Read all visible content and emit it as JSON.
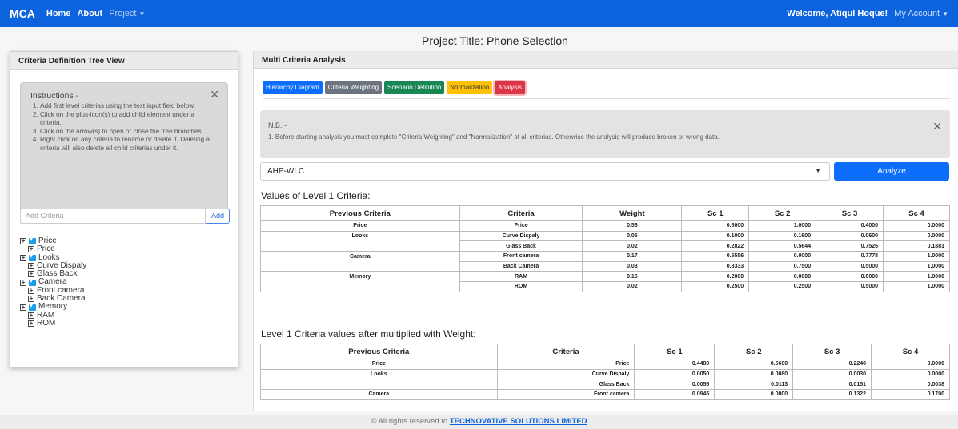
{
  "navbar": {
    "brand": "MCA",
    "home": "Home",
    "about": "About",
    "project": "Project",
    "welcome": "Welcome, Atiqul Hoque!",
    "account": "My Account"
  },
  "project_title": "Project Title: Phone Selection",
  "left_panel": {
    "title": "Criteria Definition Tree View",
    "instructions_title": "Instructions -",
    "instructions": [
      "Add first level criterias using the text input field below.",
      "Click on the plus-icon(s) to add child element under a criteria.",
      "Click on the arrow(s) to open or close the tree branches.",
      "Right click on any criteria to rename or delete it. Deleting a criteria will also delete all child criterias under it."
    ],
    "add_placeholder": "Add Criteria",
    "add_button": "Add",
    "tree": [
      {
        "label": "Price",
        "children": [
          "Price"
        ]
      },
      {
        "label": "Looks",
        "children": [
          "Curve Dispaly",
          "Glass Back"
        ]
      },
      {
        "label": "Camera",
        "children": [
          "Front camera",
          "Back Camera"
        ]
      },
      {
        "label": "Memory",
        "children": [
          "RAM",
          "ROM"
        ]
      }
    ]
  },
  "right_panel": {
    "title": "Multi Criteria Analysis",
    "tabs": [
      "Hierarchy Diagram",
      "Criteria Weighting",
      "Scenario Definition",
      "Normalization",
      "Analysis"
    ],
    "nb_title": "N.B. -",
    "nb_text": "1. Before starting analysis you must complete \"Criteria Weighting\" and \"Normalization\" of all criterias. Otherwise the analysis will produce broken or wrong data.",
    "method": "AHP-WLC",
    "analyze": "Analyze",
    "table1_title": "Values of Level 1 Criteria:",
    "table1_headers": [
      "Previous Criteria",
      "Criteria",
      "Weight",
      "Sc 1",
      "Sc 2",
      "Sc 3",
      "Sc 4"
    ],
    "table1_rows": [
      [
        "Price",
        "Price",
        "0.56",
        "0.8000",
        "1.0000",
        "0.4000",
        "0.0000"
      ],
      [
        "Looks",
        "Curve Dispaly",
        "0.05",
        "0.1000",
        "0.1600",
        "0.0600",
        "0.0000"
      ],
      [
        "",
        "Glass Back",
        "0.02",
        "0.2822",
        "0.5644",
        "0.7526",
        "0.1881"
      ],
      [
        "Camera",
        "Front camera",
        "0.17",
        "0.5556",
        "0.0000",
        "0.7778",
        "1.0000"
      ],
      [
        "",
        "Back Camera",
        "0.03",
        "0.8333",
        "0.7500",
        "0.5000",
        "1.0000"
      ],
      [
        "Memory",
        "RAM",
        "0.15",
        "0.2000",
        "0.0000",
        "0.6000",
        "1.0000"
      ],
      [
        "",
        "ROM",
        "0.02",
        "0.2500",
        "0.2500",
        "0.5000",
        "1.0000"
      ]
    ],
    "table2_title": "Level 1 Criteria values after multiplied with Weight:",
    "table2_headers": [
      "Previous Criteria",
      "Criteria",
      "Sc 1",
      "Sc 2",
      "Sc 3",
      "Sc 4"
    ],
    "table2_rows": [
      [
        "Price",
        "Price",
        "0.4480",
        "0.5600",
        "0.2240",
        "0.0000"
      ],
      [
        "Looks",
        "Curve Dispaly",
        "0.0050",
        "0.0080",
        "0.0030",
        "0.0000"
      ],
      [
        "",
        "Glass Back",
        "0.0056",
        "0.0113",
        "0.0151",
        "0.0038"
      ],
      [
        "Camera",
        "Front camera",
        "0.0945",
        "0.0000",
        "0.1322",
        "0.1700"
      ]
    ]
  },
  "footer": {
    "text": "© All rights reserved to",
    "company": "TECHNOVATIVE SOLUTIONS LIMITED"
  }
}
